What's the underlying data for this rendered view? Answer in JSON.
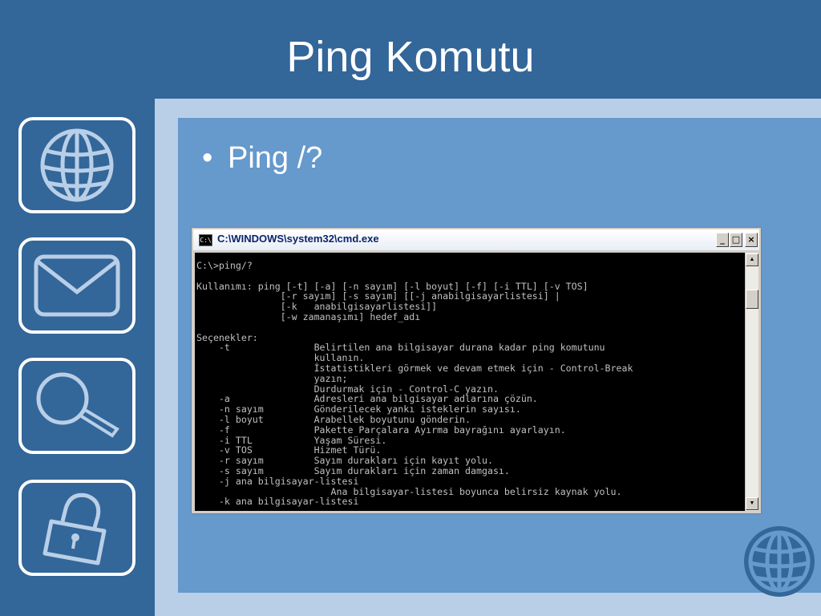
{
  "slide": {
    "title": "Ping Komutu",
    "bullet_marker": "•",
    "bullet": "Ping /?"
  },
  "icons": {
    "side": [
      "globe-icon",
      "envelope-icon",
      "magnifier-icon",
      "padlock-icon"
    ],
    "corner": "globe-icon"
  },
  "colors": {
    "background": "#336699",
    "frame": "#b8cfe7",
    "panel": "#6699cc",
    "text": "#ffffff",
    "console_bg": "#000000",
    "console_text": "#c0c0c0"
  },
  "cmd_window": {
    "icon_label": "C:\\",
    "title": "C:\\WINDOWS\\system32\\cmd.exe",
    "minimize_label": "_",
    "maximize_label": "□",
    "close_label": "×",
    "scroll_up_label": "▲",
    "scroll_down_label": "▼",
    "console_lines": [
      "C:\\>ping/?",
      "",
      "Kullanımı: ping [-t] [-a] [-n sayım] [-l boyut] [-f] [-i TTL] [-v TOS]",
      "               [-r sayım] [-s sayım] [[-j anabilgisayarlistesi] |",
      "               [-k   anabilgisayarlistesi]]",
      "               [-w zamanaşımı] hedef_adı",
      "",
      "Seçenekler:",
      "    -t               Belirtilen ana bilgisayar durana kadar ping komutunu",
      "                     kullanın.",
      "                     İstatistikleri görmek ve devam etmek için - Control-Break",
      "                     yazın;",
      "                     Durdurmak için - Control-C yazın.",
      "    -a               Adresleri ana bilgisayar adlarına çözün.",
      "    -n sayım         Gönderilecek yankı isteklerin sayısı.",
      "    -l boyut         Arabellek boyutunu gönderin.",
      "    -f               Pakette Parçalara Ayırma bayrağını ayarlayın.",
      "    -i TTL           Yaşam Süresi.",
      "    -v TOS           Hizmet Türü.",
      "    -r sayım         Sayım durakları için kayıt yolu.",
      "    -s sayım         Sayım durakları için zaman damgası.",
      "    -j ana bilgisayar-listesi",
      "                        Ana bilgisayar-listesi boyunca belirsiz kaynak yolu.",
      "    -k ana bilgisayar-listesi"
    ]
  }
}
